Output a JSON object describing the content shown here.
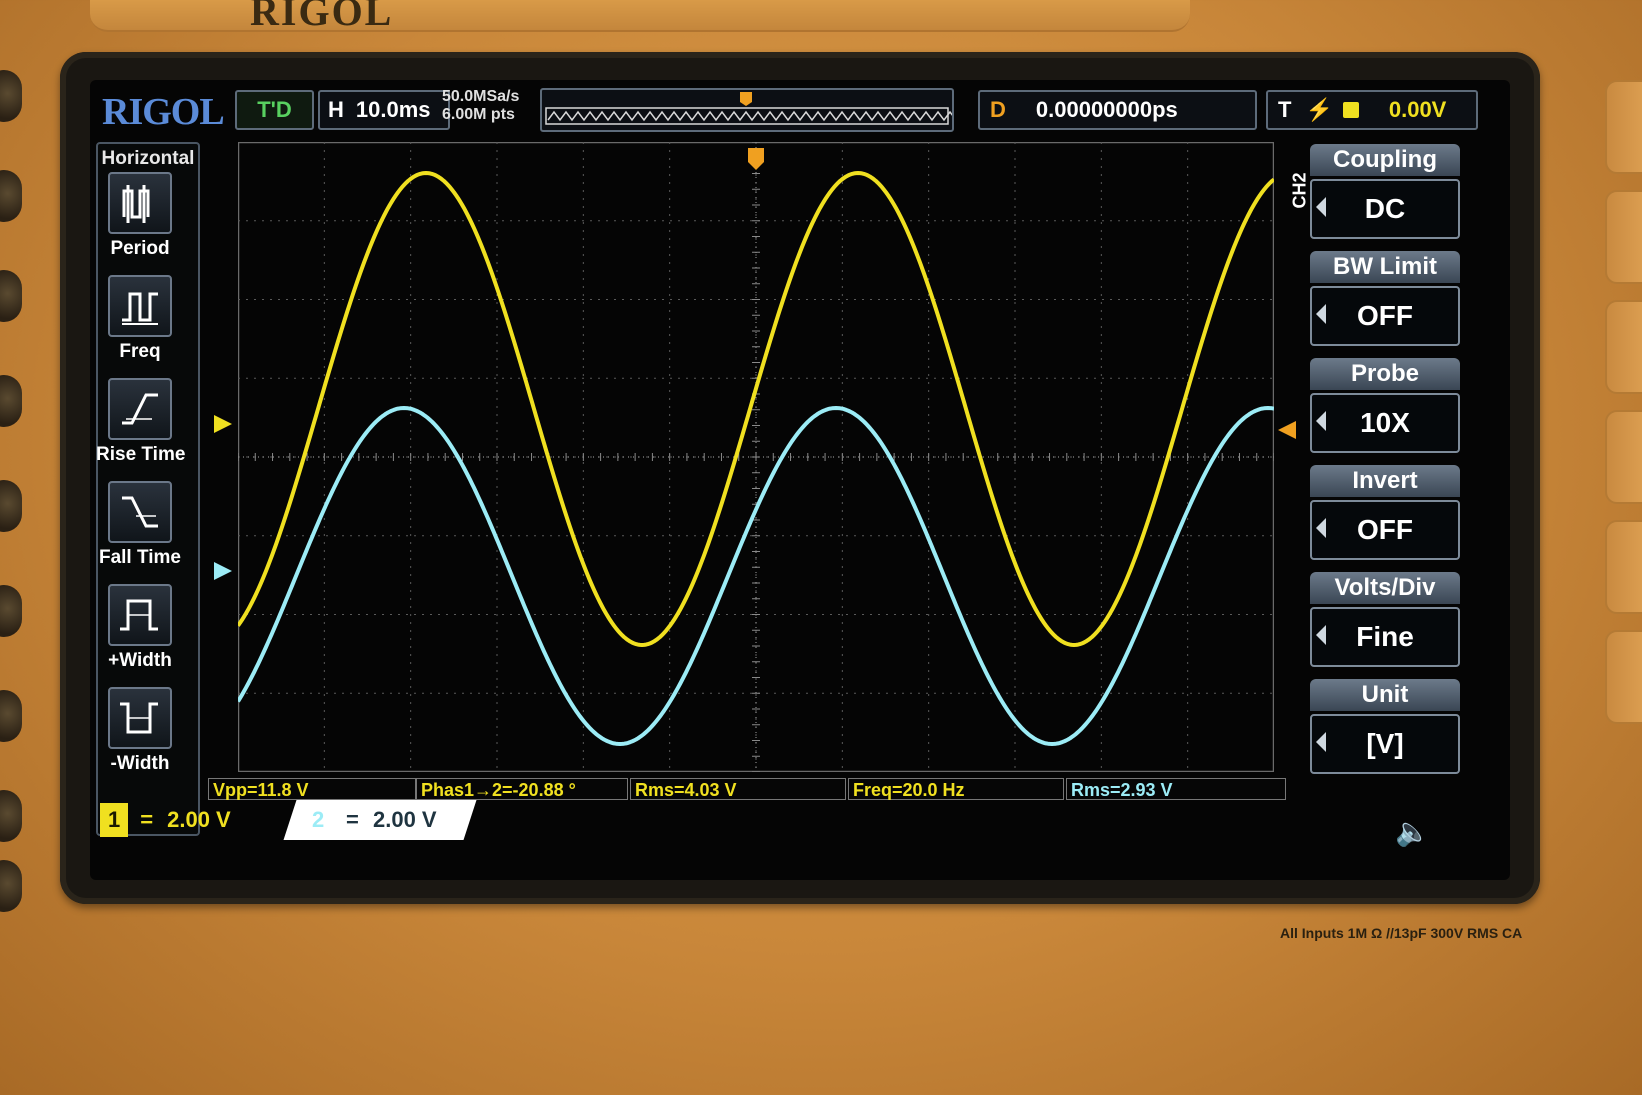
{
  "bezel": {
    "brand": "RIGOL"
  },
  "top_bar": {
    "logo": "RIGOL",
    "status": "T'D",
    "horizontal_key": "H",
    "timebase": "10.0ms",
    "sample_rate": "50.0MSa/s",
    "memory_depth": "6.00M pts",
    "delay_key": "D",
    "delay_value": "0.00000000ps",
    "trigger_key": "T",
    "trigger_level": "0.00V"
  },
  "horizontal_menu": {
    "title": "Horizontal",
    "items": [
      {
        "label": "Period",
        "icon": "period-icon"
      },
      {
        "label": "Freq",
        "icon": "frequency-icon"
      },
      {
        "label": "Rise Time",
        "icon": "rise-time-icon"
      },
      {
        "label": "Fall Time",
        "icon": "fall-time-icon"
      },
      {
        "label": "+Width",
        "icon": "positive-width-icon"
      },
      {
        "label": "-Width",
        "icon": "negative-width-icon"
      }
    ]
  },
  "channel_menu": {
    "channel_tag": "CH2",
    "items": [
      {
        "label": "Coupling",
        "value": "DC"
      },
      {
        "label": "BW Limit",
        "value": "OFF"
      },
      {
        "label": "Probe",
        "value": "10X"
      },
      {
        "label": "Invert",
        "value": "OFF"
      },
      {
        "label": "Volts/Div",
        "value": "Fine"
      },
      {
        "label": "Unit",
        "value": "[V]"
      }
    ]
  },
  "measurements": [
    "Vpp=11.8 V",
    "Phas1→2=-20.88 °",
    "Rms=4.03 V",
    "Freq=20.0 Hz",
    "Rms=2.93 V"
  ],
  "channels": {
    "ch1": {
      "number": "1",
      "coupling_symbol": "=",
      "scale": "2.00 V",
      "color": "#f0e020"
    },
    "ch2": {
      "number": "2",
      "coupling_symbol": "=",
      "scale": "2.00 V",
      "color": "#8fe8f4"
    }
  },
  "panel_label": "All Inputs 1M Ω //13pF 300V RMS CA",
  "colors": {
    "ch1": "#f0e020",
    "ch2": "#9cecf6",
    "grid": "#5a5a5a",
    "trigger": "#f0a020"
  }
}
